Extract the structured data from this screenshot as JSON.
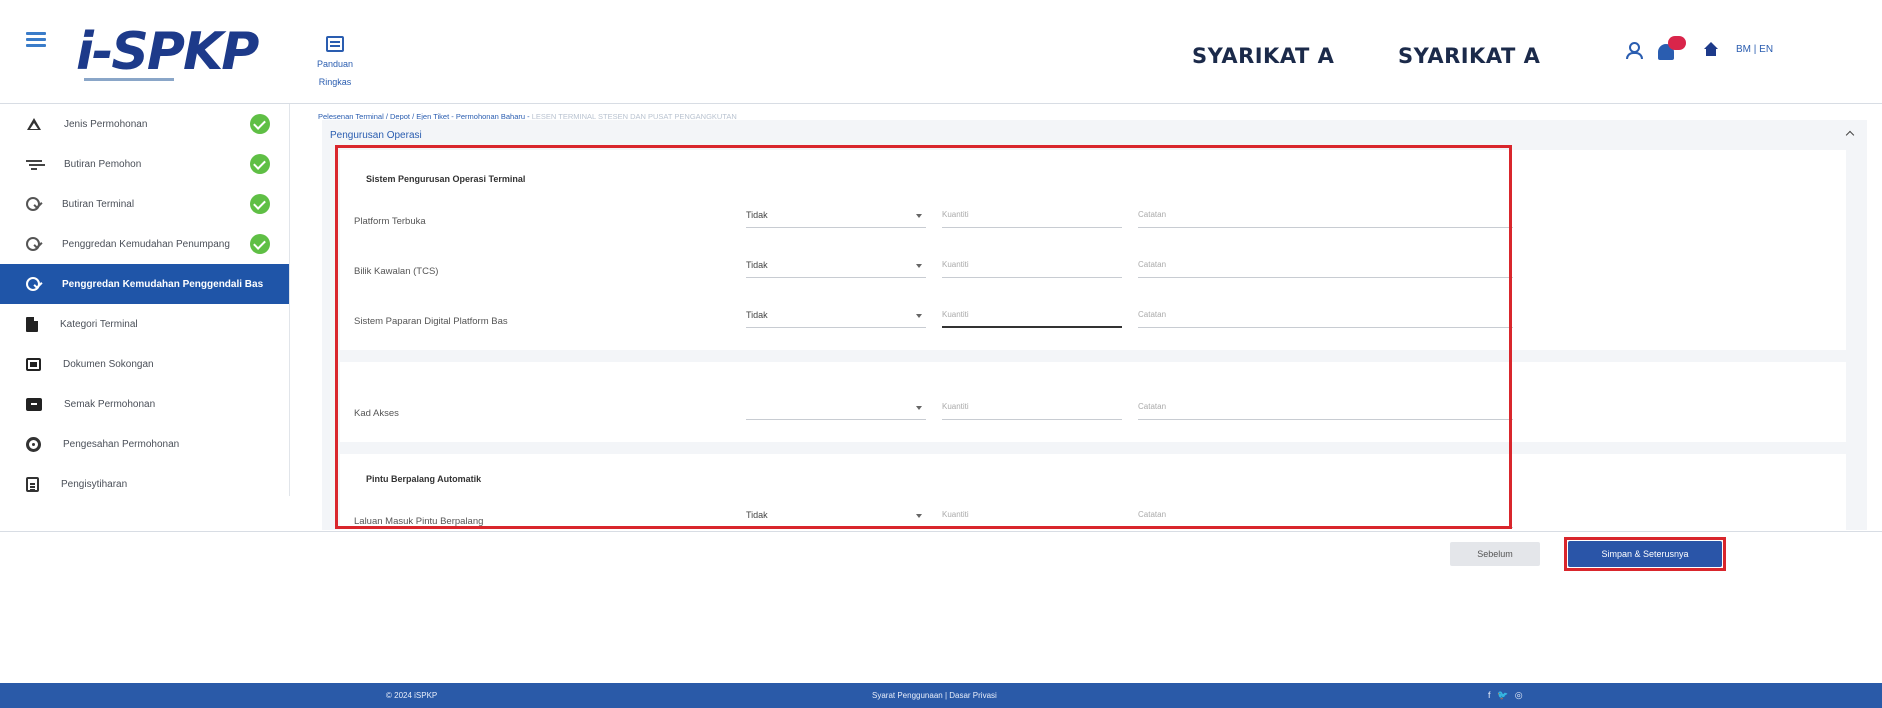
{
  "header": {
    "logo_text": "i-SPKP",
    "guide_label": "Panduan Ringkas",
    "company_1": "SYARIKAT A",
    "company_2": "SYARIKAT A",
    "lang_bm": "BM",
    "lang_sep": "|",
    "lang_en": "EN"
  },
  "sidebar": {
    "items": [
      {
        "label": "Jenis Permohonan",
        "icon": "triangle-icon",
        "done": true
      },
      {
        "label": "Butiran Pemohon",
        "icon": "filter-icon",
        "done": true
      },
      {
        "label": "Butiran Terminal",
        "icon": "check-circle-icon",
        "done": true
      },
      {
        "label": "Penggredan Kemudahan Penumpang",
        "icon": "check-circle-icon",
        "done": true
      },
      {
        "label": "Penggredan Kemudahan Penggendali Bas",
        "icon": "check-circle-icon",
        "active": true
      },
      {
        "label": "Kategori Terminal",
        "icon": "document-icon"
      },
      {
        "label": "Dokumen Sokongan",
        "icon": "cards-icon"
      },
      {
        "label": "Semak Permohonan",
        "icon": "review-icon"
      },
      {
        "label": "Pengesahan Permohonan",
        "icon": "ring-icon"
      },
      {
        "label": "Pengisytiharan",
        "icon": "calendar-icon"
      }
    ]
  },
  "breadcrumb": {
    "path": "Pelesenan Terminal / Depot / Ejen Tiket - Permohonan Baharu - ",
    "current": "LESEN TERMINAL STESEN DAN PUSAT PENGANGKUTAN"
  },
  "panel": {
    "title": "Pengurusan Operasi",
    "section_1": {
      "heading": "Sistem Pengurusan Operasi Terminal",
      "rows": [
        {
          "label": "Platform Terbuka",
          "select": "Tidak",
          "qty_placeholder": "Kuantiti",
          "note_placeholder": "Catatan"
        },
        {
          "label": "Bilik Kawalan (TCS)",
          "select": "Tidak",
          "qty_placeholder": "Kuantiti",
          "note_placeholder": "Catatan"
        },
        {
          "label": "Sistem Paparan Digital Platform Bas",
          "select": "Tidak",
          "qty_placeholder": "Kuantiti",
          "note_placeholder": "Catatan"
        }
      ]
    },
    "section_2": {
      "rows": [
        {
          "label": "Kad Akses",
          "select": "",
          "qty_placeholder": "Kuantiti",
          "note_placeholder": "Catatan"
        }
      ]
    },
    "section_3": {
      "heading": "Pintu Berpalang Automatik",
      "rows": [
        {
          "label": "Laluan Masuk Pintu Berpalang",
          "select": "Tidak",
          "qty_placeholder": "Kuantiti",
          "note_placeholder": "Catatan"
        }
      ]
    }
  },
  "actions": {
    "previous": "Sebelum",
    "save_next": "Simpan & Seterusnya"
  },
  "footer": {
    "copyright": "© 2024 iSPKP",
    "links": "Syarat Penggunaan | Dasar Privasi",
    "social": [
      "f",
      "🐦",
      "◎"
    ]
  },
  "colors": {
    "primary": "#1f55a8",
    "footer": "#2a5aa8",
    "success": "#5fbf45",
    "highlight": "#d9262c"
  }
}
